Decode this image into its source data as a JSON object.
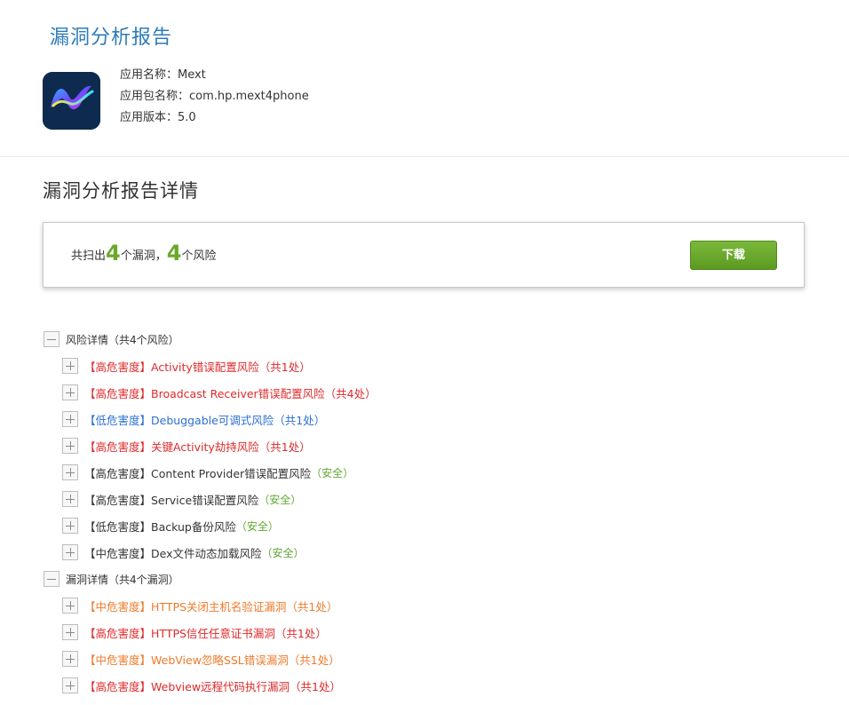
{
  "report": {
    "title": "漏洞分析报告"
  },
  "app": {
    "name_line": "应用名称：Mext",
    "package_line": "应用包名称：com.hp.mext4phone",
    "version_line": "应用版本：5.0",
    "icon_text": "Mext"
  },
  "details": {
    "heading": "漏洞分析报告详情"
  },
  "summary": {
    "prefix": "共扫出",
    "vuln_count": "4",
    "mid": "个漏洞，",
    "risk_count": "4",
    "suffix": "个风险",
    "download_label": "下载"
  },
  "tree": {
    "risk_group": {
      "label": "风险详情（共4个风险）",
      "items": [
        {
          "text": "【高危害度】Activity错误配置风险（共1处）",
          "tag": ""
        },
        {
          "text": "【高危害度】Broadcast Receiver错误配置风险（共4处）",
          "tag": ""
        },
        {
          "text": "【低危害度】Debuggable可调式风险（共1处）",
          "tag": ""
        },
        {
          "text": "【高危害度】关键Activity劫持风险（共1处）",
          "tag": ""
        },
        {
          "text": "【高危害度】Content Provider错误配置风险",
          "tag": "（安全）"
        },
        {
          "text": "【高危害度】Service错误配置风险",
          "tag": "（安全）"
        },
        {
          "text": "【低危害度】Backup备份风险",
          "tag": "（安全）"
        },
        {
          "text": "【中危害度】Dex文件动态加载风险",
          "tag": "（安全）"
        }
      ]
    },
    "vuln_group": {
      "label": "漏洞详情（共4个漏洞）",
      "items": [
        {
          "text": "【中危害度】HTTPS关闭主机名验证漏洞（共1处）",
          "tag": ""
        },
        {
          "text": "【高危害度】HTTPS信任任意证书漏洞（共1处）",
          "tag": ""
        },
        {
          "text": "【中危害度】WebView忽略SSL错误漏洞（共1处）",
          "tag": ""
        },
        {
          "text": "【高危害度】Webview远程代码执行漏洞（共1处）",
          "tag": ""
        }
      ]
    }
  },
  "colors": {
    "title_blue": "#2e7bb8",
    "high": "#e0292a",
    "low": "#2a6fd1",
    "mid": "#ef7a2a",
    "safe_green": "#5fa832",
    "count_green": "#6aa82a",
    "button_green": "#6aaa2e"
  }
}
